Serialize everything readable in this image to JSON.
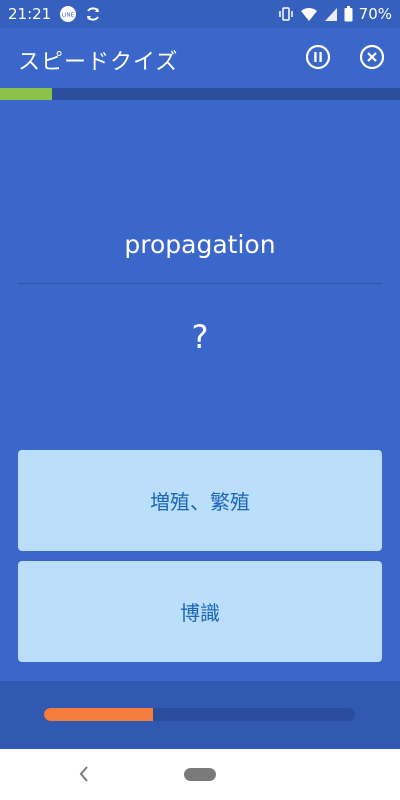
{
  "status_bar": {
    "time": "21:21",
    "battery": "70%",
    "icons": [
      "line-app-icon",
      "sync-icon",
      "vibrate-icon",
      "wifi-icon",
      "cell-signal-icon",
      "battery-icon"
    ]
  },
  "app_bar": {
    "title": "スピードクイズ",
    "pause_icon": "pause-circle-icon",
    "close_icon": "close-circle-icon"
  },
  "quiz": {
    "progress_fraction": 0.13,
    "word": "propagation",
    "answer_placeholder": "?",
    "choices": [
      {
        "label": "増殖、繁殖"
      },
      {
        "label": "博識"
      }
    ],
    "timer_fraction": 0.35
  },
  "colors": {
    "background": "#3a67c9",
    "progress_accent": "#8bc34a",
    "timer_accent": "#f47c3c",
    "choice_background": "#bbdefb",
    "choice_text": "#1b66b5"
  },
  "nav_bar": {
    "back_icon": "back-chevron-icon",
    "home_icon": "home-pill-icon"
  }
}
